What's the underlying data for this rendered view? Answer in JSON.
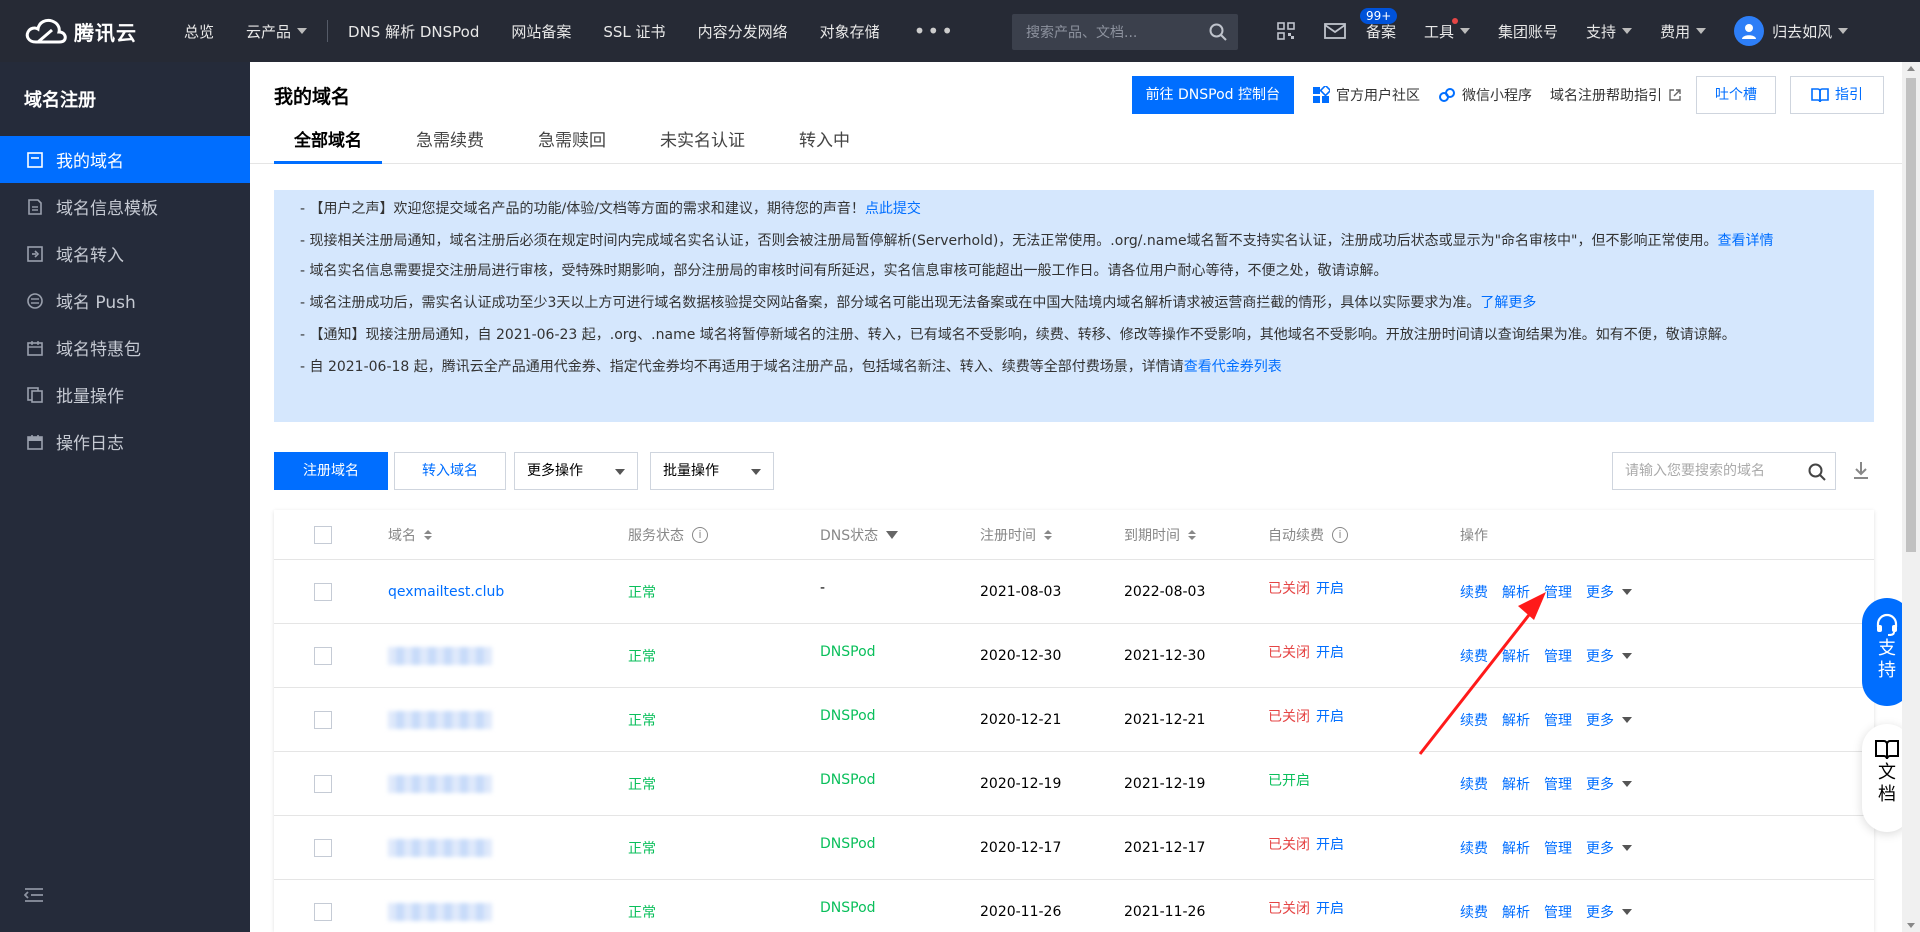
{
  "topnav": {
    "brand": "腾讯云",
    "items": [
      "总览",
      "云产品",
      "DNS 解析 DNSPod",
      "网站备案",
      "SSL 证书",
      "内容分发网络",
      "对象存储"
    ],
    "more": "•••",
    "search_placeholder": "搜索产品、文档...",
    "badge": "99+",
    "right_items": [
      "备案",
      "工具",
      "集团账号",
      "支持",
      "费用"
    ],
    "user": "归去如风"
  },
  "sidebar": {
    "title": "域名注册",
    "items": [
      {
        "label": "我的域名",
        "icon": "list-icon",
        "active": true
      },
      {
        "label": "域名信息模板",
        "icon": "document-icon"
      },
      {
        "label": "域名转入",
        "icon": "transfer-in-icon"
      },
      {
        "label": "域名 Push",
        "icon": "push-icon"
      },
      {
        "label": "域名特惠包",
        "icon": "gift-icon"
      },
      {
        "label": "批量操作",
        "icon": "batch-icon"
      },
      {
        "label": "操作日志",
        "icon": "calendar-icon"
      }
    ]
  },
  "header": {
    "title": "我的域名",
    "tabs": [
      "全部域名",
      "急需续费",
      "急需赎回",
      "未实名认证",
      "转入中"
    ],
    "actions": {
      "dnspod": "前往 DNSPod 控制台",
      "community": "官方用户社区",
      "miniprogram": "微信小程序",
      "help": "域名注册帮助指引",
      "feedback": "吐个槽",
      "guide": "指引"
    }
  },
  "notice": {
    "lines": [
      {
        "text": "- 【用户之声】欢迎您提交域名产品的功能/体验/文档等方面的需求和建议，期待您的声音！",
        "link": "点此提交"
      },
      {
        "text": "- 现接相关注册局通知，域名注册后必须在规定时间内完成域名实名认证，否则会被注册局暂停解析(Serverhold)，无法正常使用。.org/.name域名暂不支持实名认证，注册成功后状态或显示为\"命名审核中\"，但不影响正常使用。",
        "link": "查看详情"
      },
      {
        "text": "- 域名实名信息需要提交注册局进行审核，受特殊时期影响，部分注册局的审核时间有所延迟，实名信息审核可能超出一般工作日。请各位用户耐心等待，不便之处，敬请谅解。",
        "link": ""
      },
      {
        "text": "- 域名注册成功后，需实名认证成功至少3天以上方可进行域名数据核验提交网站备案，部分域名可能出现无法备案或在中国大陆境内域名解析请求被运营商拦截的情形，具体以实际要求为准。",
        "link": "了解更多"
      },
      {
        "text": "- 【通知】现接注册局通知，自 2021-06-23 起，.org、.name 域名将暂停新域名的注册、转入，已有域名不受影响，续费、转移、修改等操作不受影响，其他域名不受影响。开放注册时间请以查询结果为准。如有不便，敬请谅解。",
        "link": ""
      },
      {
        "text": "- 自 2021-06-18 起，腾讯云全产品通用代金券、指定代金券均不再适用于域名注册产品，包括域名新注、转入、续费等全部付费场景，详情请",
        "link": "查看代金券列表"
      }
    ]
  },
  "toolbar": {
    "register": "注册域名",
    "transfer": "转入域名",
    "more_ops": "更多操作",
    "batch_ops": "批量操作",
    "search_placeholder": "请输入您要搜索的域名"
  },
  "table": {
    "columns": [
      "域名",
      "服务状态",
      "DNS状态",
      "注册时间",
      "到期时间",
      "自动续费",
      "操作"
    ],
    "rows": [
      {
        "domain": "qexmailtest.club",
        "status": "正常",
        "dns": "-",
        "reg": "2021-08-03",
        "exp": "2022-08-03",
        "auto": "已关闭",
        "auto_action": "开启"
      },
      {
        "domain": "",
        "status": "正常",
        "dns": "DNSPod",
        "reg": "2020-12-30",
        "exp": "2021-12-30",
        "auto": "已关闭",
        "auto_action": "开启"
      },
      {
        "domain": "",
        "status": "正常",
        "dns": "DNSPod",
        "reg": "2020-12-21",
        "exp": "2021-12-21",
        "auto": "已关闭",
        "auto_action": "开启"
      },
      {
        "domain": "",
        "status": "正常",
        "dns": "DNSPod",
        "reg": "2020-12-19",
        "exp": "2021-12-19",
        "auto": "已开启",
        "auto_action": ""
      },
      {
        "domain": "",
        "status": "正常",
        "dns": "DNSPod",
        "reg": "2020-12-17",
        "exp": "2021-12-17",
        "auto": "已关闭",
        "auto_action": "开启"
      },
      {
        "domain": "",
        "status": "正常",
        "dns": "DNSPod",
        "reg": "2020-11-26",
        "exp": "2021-11-26",
        "auto": "已关闭",
        "auto_action": "开启"
      }
    ],
    "ops": [
      "续费",
      "解析",
      "管理",
      "更多"
    ]
  },
  "float": {
    "support": [
      "支",
      "持"
    ],
    "docs": [
      "文",
      "档"
    ]
  },
  "colors": {
    "brand": "#006eff",
    "nav_bg": "#262a35",
    "sidebar_bg": "#252b3a",
    "success": "#0abf5b",
    "danger": "#e54545",
    "annotation_arrow": "#ff1a1a"
  }
}
